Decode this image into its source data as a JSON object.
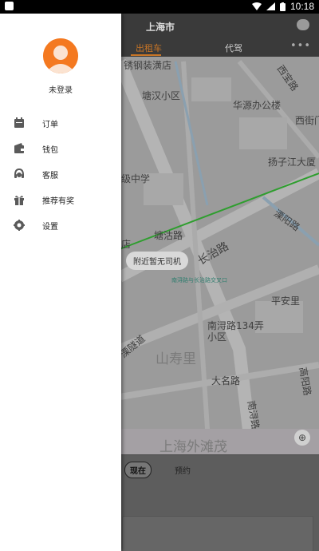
{
  "status_bar": {
    "time": "10:18"
  },
  "header": {
    "city": "上海市"
  },
  "service_tabs": [
    {
      "label": "出租车",
      "active": true
    },
    {
      "label": "代驾",
      "active": false
    }
  ],
  "map": {
    "labels": [
      "锈钢装潢店",
      "塘汉小区",
      "华源办公楼",
      "西宝路",
      "西街门",
      "扬子江大厦",
      "级中学",
      "溧阳路",
      "塘沽路",
      "长治路",
      "店",
      "平安里",
      "南浔路134弄小区",
      "溧隧道",
      "山寿里",
      "大名路",
      "南浔路",
      "高阳路",
      "上海外滩茂",
      "南浔路与长治路交叉口"
    ],
    "status_tooltip": "附近暂无司机"
  },
  "booking": {
    "now_label": "现在",
    "reserve_label": "预约"
  },
  "drawer": {
    "login_label": "未登录",
    "menu": [
      {
        "label": "订单",
        "icon": "order-icon"
      },
      {
        "label": "钱包",
        "icon": "wallet-icon"
      },
      {
        "label": "客服",
        "icon": "support-icon"
      },
      {
        "label": "推荐有奖",
        "icon": "gift-icon"
      },
      {
        "label": "设置",
        "icon": "gear-icon"
      }
    ]
  },
  "colors": {
    "accent": "#f47920",
    "tab_active": "#c87526",
    "route_green": "#2e9e2e"
  }
}
